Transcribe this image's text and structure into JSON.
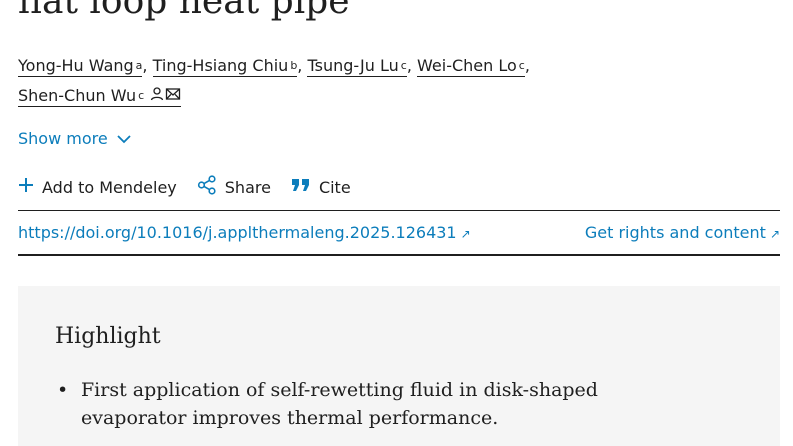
{
  "article": {
    "title_fragment": "flat loop heat pipe"
  },
  "authors": [
    {
      "name": "Yong-Hu Wang",
      "sup": "a"
    },
    {
      "name": "Ting-Hsiang Chiu",
      "sup": "b"
    },
    {
      "name": "Tsung-Ju Lu",
      "sup": "c"
    },
    {
      "name": "Wei-Chen Lo",
      "sup": "c"
    },
    {
      "name": "Shen-Chun Wu",
      "sup": "c"
    }
  ],
  "author_separator": ",",
  "show_more": "Show more",
  "actions": {
    "mendeley": "Add to Mendeley",
    "share": "Share",
    "cite": "Cite"
  },
  "doi": {
    "url": "https://doi.org/10.1016/j.applthermaleng.2025.126431",
    "rights": "Get rights and content",
    "external_glyph": "↗"
  },
  "highlights": {
    "title": "Highlight",
    "items": [
      "First application of self-rewetting fluid in disk-shaped evaporator improves thermal performance."
    ]
  },
  "colors": {
    "link": "#0c7dbb",
    "text": "#1f1f1f",
    "highlight_bg": "#f5f5f5"
  },
  "icons": [
    "person-icon",
    "envelope-icon",
    "chevron-down-icon",
    "plus-icon",
    "share-icon",
    "quote-icon",
    "external-link-icon"
  ]
}
